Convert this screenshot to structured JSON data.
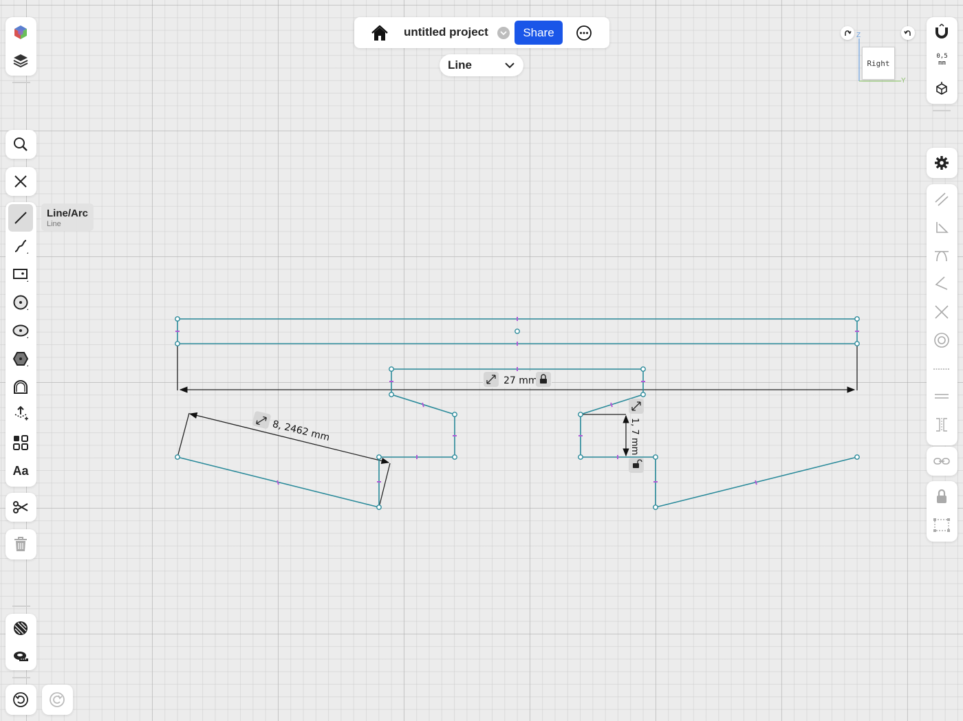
{
  "project": {
    "title": "untitled project",
    "share_label": "Share"
  },
  "mode_select": {
    "selected": "Line"
  },
  "tool_tooltip": {
    "title": "Line/Arc",
    "subtitle": "Line"
  },
  "view": {
    "orientation": "Right",
    "axis_z": "Z",
    "axis_y": "Y"
  },
  "grid": {
    "scale_value": "0,5",
    "scale_unit": "mm"
  },
  "dimensions": {
    "horizontal": "27 mm",
    "slanted": "8, 2462 mm",
    "vertical": "1, 7 mm"
  },
  "colors": {
    "accent": "#1a56e8",
    "sketch_line": "#2a8a9a",
    "midpoint": "#b05ad6"
  },
  "left_toolbar": [
    "appearance-icon",
    "layers-icon",
    "search-icon",
    "close-icon",
    "line-arc-icon",
    "spline-icon",
    "rectangle-icon",
    "circle-icon",
    "ellipse-icon",
    "polygon-icon",
    "slot-icon",
    "project-icon",
    "pattern-icon",
    "text-icon",
    "trim-icon",
    "delete-icon",
    "hatch-icon",
    "measure-icon",
    "undo-icon",
    "redo-icon"
  ],
  "right_toolbar": [
    "snap-magnet-icon",
    "view-cube-icon",
    "settings-icon",
    "parallel-icon",
    "perpendicular-icon",
    "tangent-icon",
    "angle-icon",
    "intersect-icon",
    "concentric-icon",
    "horizontal-icon",
    "equal-icon",
    "symmetric-icon",
    "link-icon",
    "lock-icon",
    "construction-box-icon"
  ]
}
